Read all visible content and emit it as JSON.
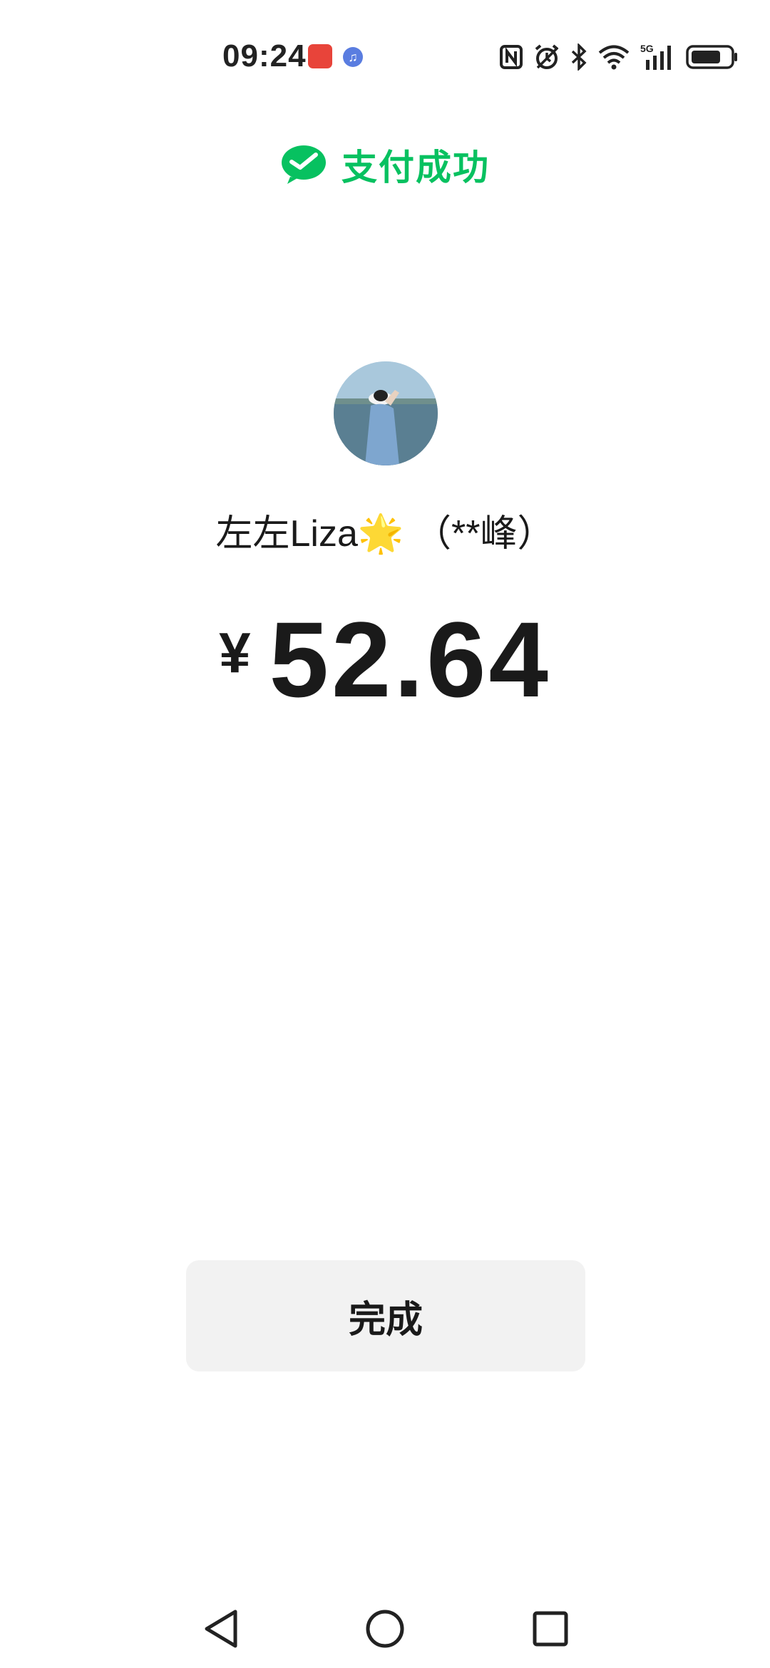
{
  "status_bar": {
    "time": "09:24",
    "network": "5G",
    "icons": [
      "huawei-store-icon",
      "music-icon",
      "nfc-icon",
      "alarm-icon",
      "bluetooth-icon",
      "wifi-icon",
      "signal-icon",
      "battery-icon"
    ]
  },
  "header": {
    "title": "支付成功",
    "icon": "wechat-pay-check-icon",
    "accent_color": "#07c160"
  },
  "payee": {
    "name": "左左Liza🌟 （**峰）"
  },
  "payment": {
    "currency": "¥",
    "amount": "52.64"
  },
  "actions": {
    "done_label": "完成"
  },
  "nav": {
    "items": [
      "back-icon",
      "home-icon",
      "recents-icon"
    ]
  }
}
